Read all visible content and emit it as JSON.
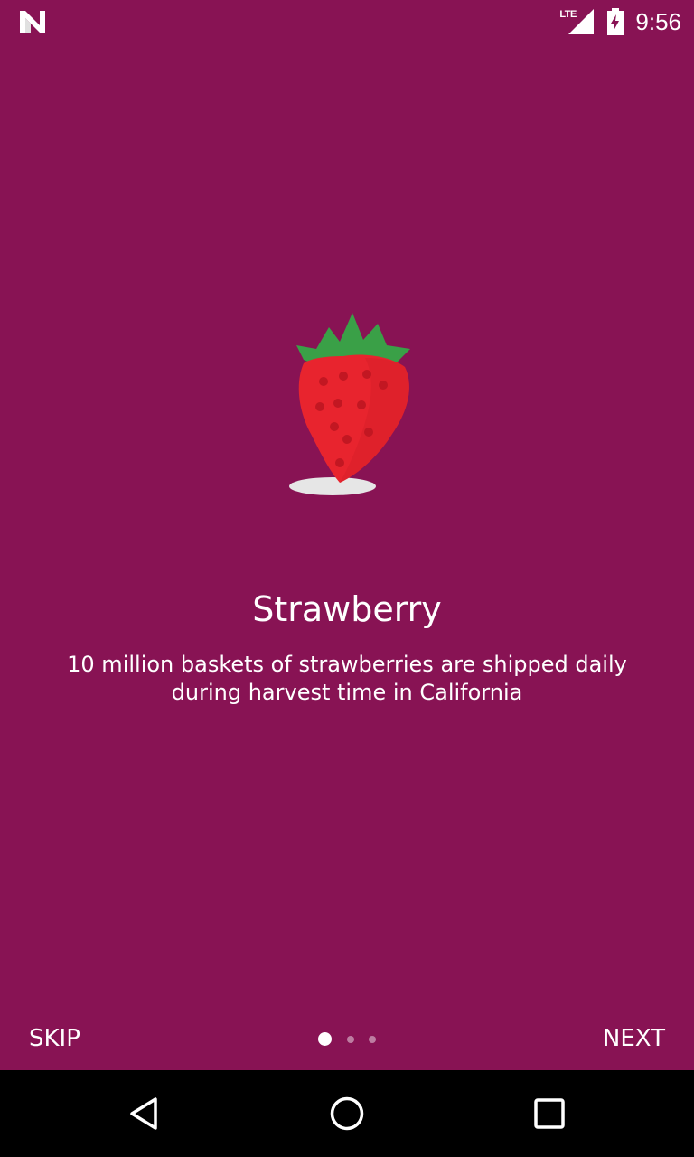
{
  "colors": {
    "background": "#881354",
    "strawberry": "#e8242e",
    "leaves": "#3aa047",
    "shadow": "#e6e6e6",
    "system_nav": "#000000"
  },
  "status_bar": {
    "notification_icon": "n-logo-icon",
    "network_label": "LTE",
    "time": "9:56"
  },
  "onboarding": {
    "illustration_icon": "strawberry-icon",
    "title": "Strawberry",
    "description": "10 million baskets of strawberries are shipped daily during harvest time in California",
    "skip_label": "SKIP",
    "next_label": "NEXT",
    "page_indicator": {
      "current": 1,
      "total": 3
    }
  },
  "system_nav": {
    "back": "back-icon",
    "home": "home-icon",
    "recents": "recents-icon"
  }
}
